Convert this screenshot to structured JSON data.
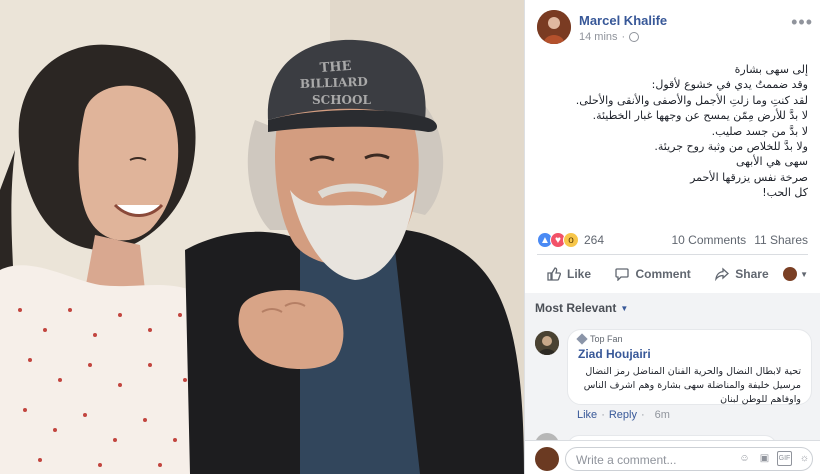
{
  "post": {
    "author": "Marcel Khalife",
    "time": "14 mins",
    "privacy_icon": "globe-icon",
    "more_icon": "ellipsis-icon",
    "lines": [
      "إلى سهى بشارة",
      "وقد ضممتُ يدي في خشوع لأقول:",
      "لقد كنتِ وما زلتِ الأجمل والأصفى والأنقى والأحلى.",
      "لا بدَّ للأرض مِمّن يمسح عن وجهها غبار الخطيئة.",
      "لا بدَّ من جسد صليب.",
      "ولا بدَّ للخلاص من وثبة روح جريئة.",
      "سهى هي الأبهى",
      "صرخة نفس يزرقها الأحمر",
      "كل الحب!"
    ]
  },
  "reactions": {
    "icons": [
      "like-reaction-icon",
      "love-reaction-icon",
      "wow-reaction-icon"
    ],
    "count": "264",
    "comments": "10 Comments",
    "shares": "11 Shares"
  },
  "actions": {
    "like": "Like",
    "comment": "Comment",
    "share": "Share"
  },
  "comments": {
    "sort_label": "Most Relevant",
    "items": [
      {
        "badge": "Top Fan",
        "name": "Ziad Houjairi",
        "lines": [
          "تحية لابطال النضال والحرية الفنان المناضل رمز النضال",
          "مرسيل خليفة والمناضلة سهى بشارة وهم اشرف الناس",
          "واوفاهم للوطن لبنان"
        ],
        "like": "Like",
        "reply": "Reply",
        "time": "6m"
      }
    ],
    "write_placeholder": "Write a comment..."
  },
  "colors": {
    "link": "#385898",
    "secondary_text": "#616770",
    "like_blue": "#4a8af4",
    "love_red": "#f25268",
    "wow_yellow": "#f7c64a"
  }
}
